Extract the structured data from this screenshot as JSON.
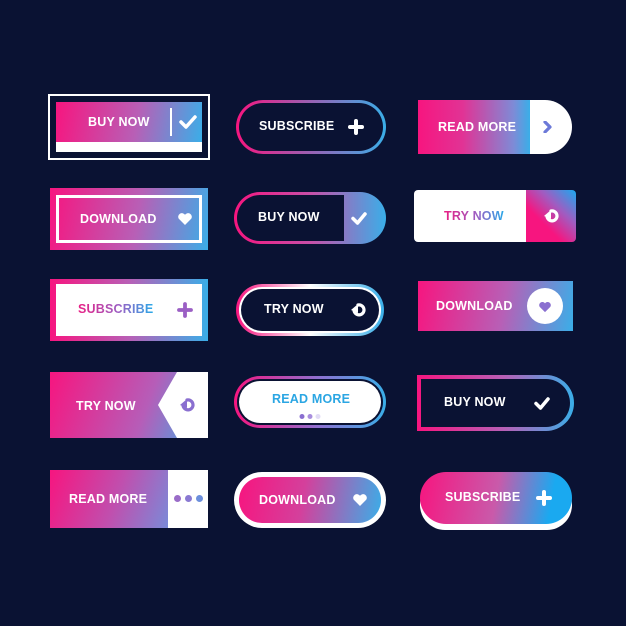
{
  "canvas": {
    "background": "#0a1233"
  },
  "colors": {
    "pink": "#f7157f",
    "purple": "#9b5fc4",
    "blue": "#3aaee8",
    "white": "#ffffff",
    "navy": "#0a1233"
  },
  "buttons": [
    {
      "id": "b1",
      "label": "BUY NOW",
      "icon": "check-icon",
      "style": "gradient-rect-double-frame"
    },
    {
      "id": "b2",
      "label": "SUBSCRIBE",
      "icon": "plus-icon",
      "style": "pill-gradient-outline"
    },
    {
      "id": "b3",
      "label": "READ MORE",
      "icon": "chevron-right-icon",
      "style": "gradient-rect-white-round-end"
    },
    {
      "id": "b4",
      "label": "DOWNLOAD",
      "icon": "heart-icon",
      "style": "gradient-rect-inner-frame"
    },
    {
      "id": "b5",
      "label": "BUY NOW",
      "icon": "check-icon",
      "style": "pill-split-gradient"
    },
    {
      "id": "b6",
      "label": "TRY NOW",
      "icon": "refresh-icon",
      "style": "white-rect-gradient-end"
    },
    {
      "id": "b7",
      "label": "SUBSCRIBE",
      "icon": "plus-icon",
      "style": "white-rect-gradient-frame"
    },
    {
      "id": "b8",
      "label": "TRY NOW",
      "icon": "refresh-icon",
      "style": "pill-dark-double-outline"
    },
    {
      "id": "b9",
      "label": "DOWNLOAD",
      "icon": "heart-icon",
      "style": "gradient-rect-circle-icon"
    },
    {
      "id": "b10",
      "label": "TRY NOW",
      "icon": "refresh-icon",
      "style": "gradient-rect-arrow-notch"
    },
    {
      "id": "b11",
      "label": "READ MORE",
      "icon": "dots-indicator",
      "style": "pill-white-gradient-outline"
    },
    {
      "id": "b12",
      "label": "BUY NOW",
      "icon": "check-icon",
      "style": "dark-rect-gradient-outline-round-end"
    },
    {
      "id": "b13",
      "label": "READ MORE",
      "icon": "ellipsis-icon",
      "style": "gradient-rect-white-end"
    },
    {
      "id": "b14",
      "label": "DOWNLOAD",
      "icon": "heart-icon",
      "style": "pill-gradient-white-frame"
    },
    {
      "id": "b15",
      "label": "SUBSCRIBE",
      "icon": "plus-icon",
      "style": "pill-gradient-3d"
    }
  ]
}
